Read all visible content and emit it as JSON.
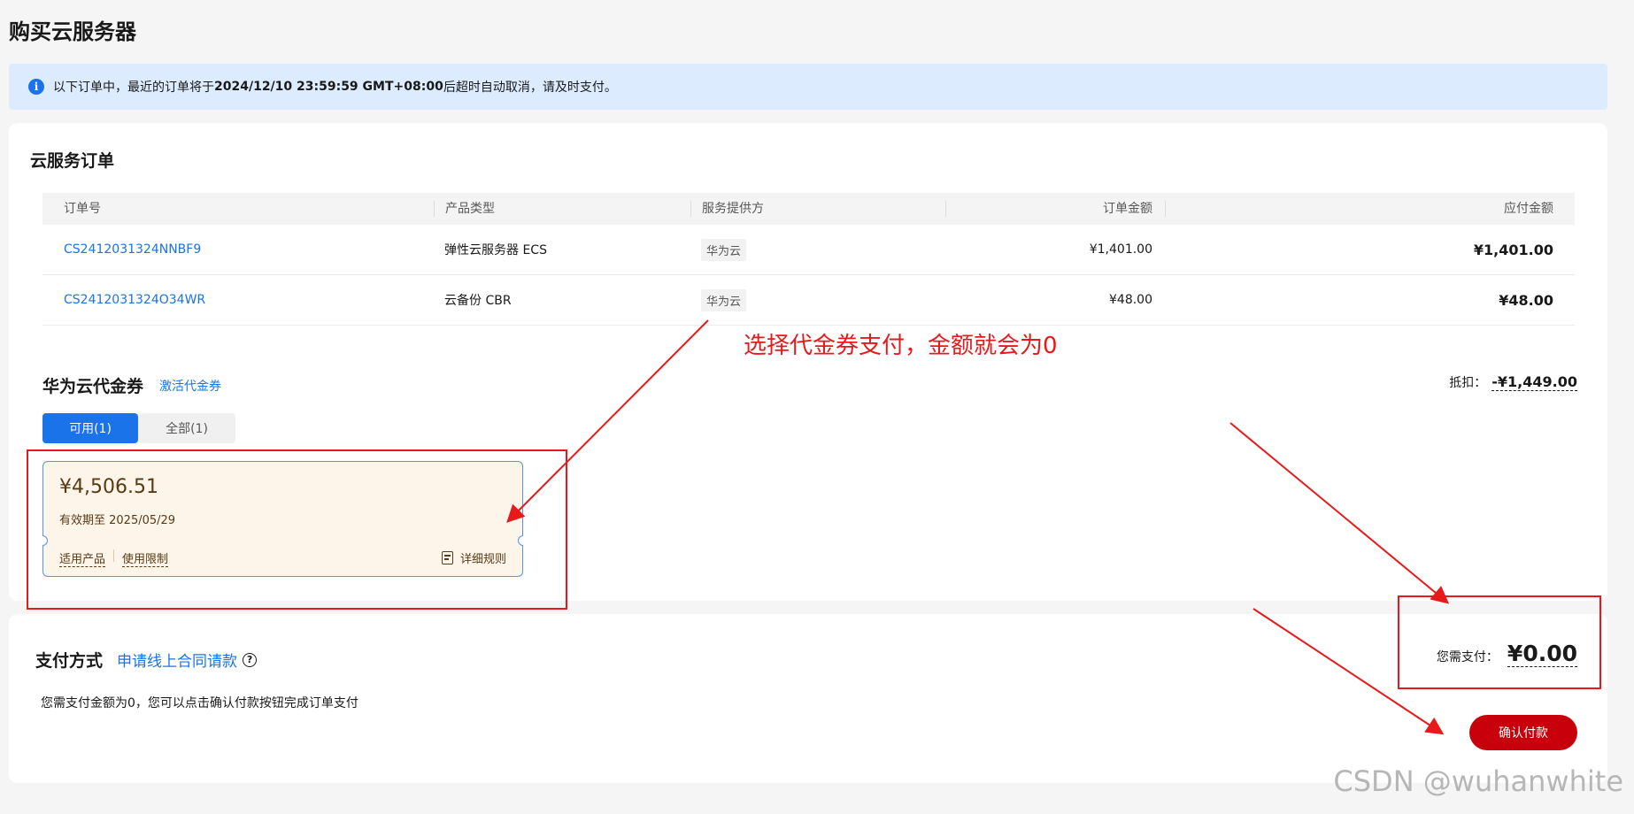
{
  "page": {
    "title": "购买云服务器"
  },
  "notice": {
    "prefix": "以下订单中，最近的订单将于 ",
    "deadline": "2024/12/10 23:59:59 GMT+08:00",
    "suffix": " 后超时自动取消，请及时支付。"
  },
  "order": {
    "title": "云服务订单",
    "columns": [
      "订单号",
      "产品类型",
      "服务提供方",
      "订单金额",
      "应付金额"
    ],
    "rows": [
      {
        "order_no": "CS2412031324NNBF9",
        "product": "弹性云服务器 ECS",
        "provider": "华为云",
        "amount": "¥1,401.00",
        "payable": "¥1,401.00"
      },
      {
        "order_no": "CS2412031324O34WR",
        "product": "云备份 CBR",
        "provider": "华为云",
        "amount": "¥48.00",
        "payable": "¥48.00"
      }
    ]
  },
  "voucher": {
    "title": "华为云代金券",
    "activate_label": "激活代金券",
    "discount_label": "抵扣：",
    "discount_amount": "-¥1,449.00",
    "tabs": [
      "可用(1)",
      "全部(1)"
    ],
    "card": {
      "amount": "¥4,506.51",
      "valid": "有效期至 2025/05/29",
      "link_products": "适用产品",
      "link_limits": "使用限制",
      "rules": "详细规则"
    }
  },
  "payment": {
    "title": "支付方式",
    "contract_link": "申请线上合同请款",
    "description": "您需支付金额为0，您可以点击确认付款按钮完成订单支付",
    "need_pay_label": "您需支付：",
    "need_pay_amount": "¥0.00",
    "confirm_label": "确认付款"
  },
  "annotation": {
    "text": "选择代金券支付，金额就会为0",
    "color": "#e8191a"
  },
  "watermark": "CSDN @wuhanwhite",
  "colors": {
    "link": "#1a73e8",
    "confirm": "#c7000b",
    "notice_bg": "#dcebfd"
  }
}
